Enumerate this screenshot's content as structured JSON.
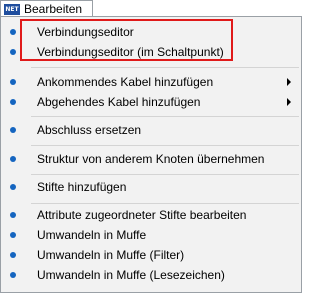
{
  "menu": {
    "icon_name": "app-logo-icon",
    "title": "Bearbeiten"
  },
  "items": [
    {
      "label": "Verbindungseditor"
    },
    {
      "label": "Verbindungseditor (im Schaltpunkt)"
    },
    {
      "label": "Ankommendes Kabel hinzufügen"
    },
    {
      "label": "Abgehendes Kabel hinzufügen"
    },
    {
      "label": "Abschluss ersetzen"
    },
    {
      "label": "Struktur von anderem Knoten übernehmen"
    },
    {
      "label": "Stifte hinzufügen"
    },
    {
      "label": "Attribute zugeordneter Stifte bearbeiten"
    },
    {
      "label": "Umwandeln in Muffe"
    },
    {
      "label": "Umwandeln in Muffe (Filter)"
    },
    {
      "label": "Umwandeln in Muffe (Lesezeichen)"
    }
  ],
  "colors": {
    "bullet": "#1565c0",
    "highlight": "#e01a1a",
    "menu_background": "#f2f2f2"
  }
}
